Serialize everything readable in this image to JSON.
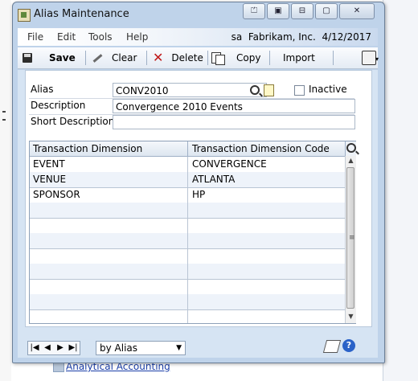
{
  "window": {
    "title": "Alias Maintenance",
    "controls": [
      "⏍",
      "▣",
      "⊟",
      "▢",
      "✕"
    ]
  },
  "menubar": {
    "items": [
      "File",
      "Edit",
      "Tools",
      "Help"
    ],
    "user": "sa",
    "company": "Fabrikam, Inc.",
    "date": "4/12/2017"
  },
  "toolbar": {
    "save_label": "Save",
    "clear_label": "Clear",
    "delete_label": "Delete",
    "copy_label": "Copy",
    "import_label": "Import"
  },
  "form": {
    "alias_label": "Alias",
    "alias_value": "CONV2010",
    "inactive_label": "Inactive",
    "inactive_checked": false,
    "description_label": "Description",
    "description_value": "Convergence 2010 Events",
    "short_description_label": "Short Description",
    "short_description_value": ""
  },
  "grid": {
    "col1_header": "Transaction Dimension",
    "col2_header": "Transaction Dimension Code",
    "rows": [
      {
        "dimension": "EVENT",
        "code": "CONVERGENCE"
      },
      {
        "dimension": "VENUE",
        "code": "ATLANTA"
      },
      {
        "dimension": "SPONSOR",
        "code": "HP"
      },
      {
        "dimension": "",
        "code": ""
      },
      {
        "dimension": "",
        "code": ""
      },
      {
        "dimension": "",
        "code": ""
      },
      {
        "dimension": "",
        "code": ""
      },
      {
        "dimension": "",
        "code": ""
      },
      {
        "dimension": "",
        "code": ""
      },
      {
        "dimension": "",
        "code": ""
      },
      {
        "dimension": "",
        "code": ""
      }
    ]
  },
  "footer": {
    "nav_buttons": [
      "|◀",
      "◀",
      "▶",
      "▶|"
    ],
    "sort_value": "by Alias"
  },
  "background": {
    "link_text": "Analytical Accounting"
  }
}
